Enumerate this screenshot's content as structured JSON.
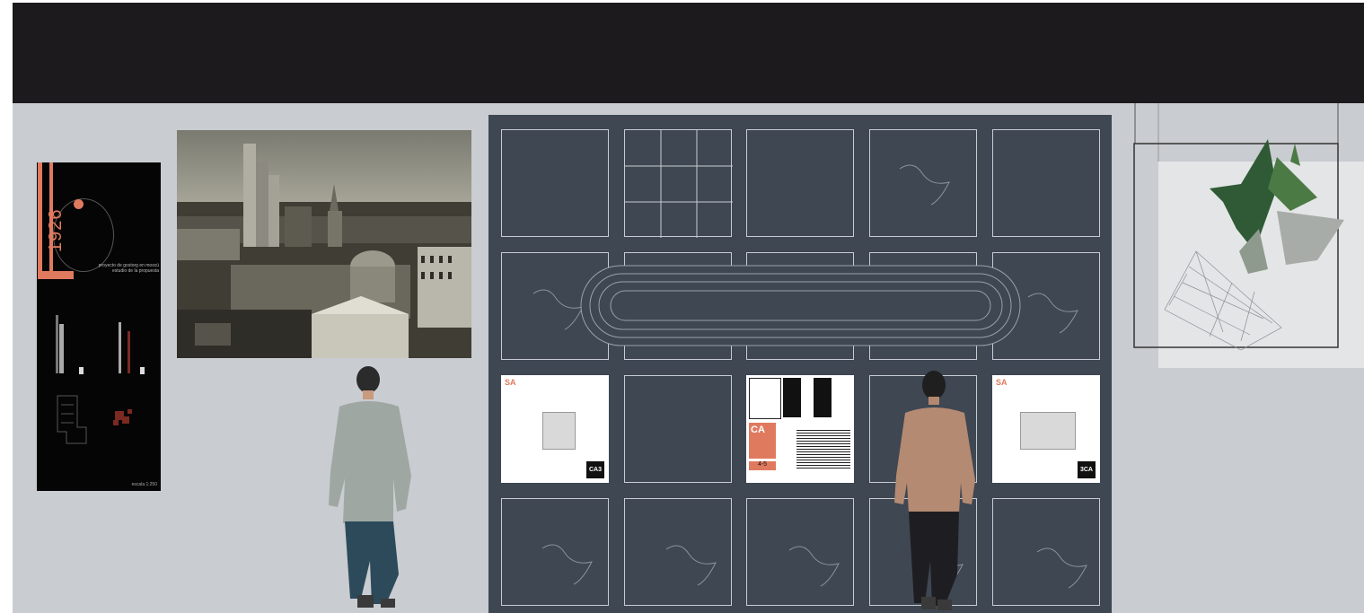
{
  "poster": {
    "year": "1926",
    "subtitle": "proyecto de gostorg en moscú",
    "caption_line": "estudio de la propuesta",
    "scale": "escala 1:250"
  },
  "panel": {
    "tiles": [
      {
        "row": 0,
        "col": 0,
        "kind": "empty"
      },
      {
        "row": 0,
        "col": 1,
        "kind": "grid"
      },
      {
        "row": 0,
        "col": 2,
        "kind": "empty"
      },
      {
        "row": 0,
        "col": 3,
        "kind": "sketch"
      },
      {
        "row": 0,
        "col": 4,
        "kind": "empty"
      },
      {
        "row": 1,
        "col": 0,
        "kind": "sketch"
      },
      {
        "row": 1,
        "col": 1,
        "kind": "empty"
      },
      {
        "row": 1,
        "col": 2,
        "kind": "empty"
      },
      {
        "row": 1,
        "col": 3,
        "kind": "empty"
      },
      {
        "row": 1,
        "col": 4,
        "kind": "sketch"
      },
      {
        "row": 2,
        "col": 0,
        "kind": "page-sa"
      },
      {
        "row": 2,
        "col": 1,
        "kind": "empty"
      },
      {
        "row": 2,
        "col": 2,
        "kind": "page-covers"
      },
      {
        "row": 2,
        "col": 3,
        "kind": "empty"
      },
      {
        "row": 2,
        "col": 4,
        "kind": "page-sa-right"
      },
      {
        "row": 3,
        "col": 0,
        "kind": "sketch"
      },
      {
        "row": 3,
        "col": 1,
        "kind": "sketch"
      },
      {
        "row": 3,
        "col": 2,
        "kind": "sketch"
      },
      {
        "row": 3,
        "col": 3,
        "kind": "sketch"
      },
      {
        "row": 3,
        "col": 4,
        "kind": "sketch"
      }
    ],
    "page_sa_label": "SA",
    "page_sa_badge": "CA3",
    "page_sa_right_badge": "3CA",
    "covers_label_ca": "CA",
    "covers_number": "4-5"
  },
  "colors": {
    "ceiling": "#1c1a1c",
    "wall": "#c9ccd0",
    "panel": "#3e4752",
    "accent": "#e07a5f"
  }
}
